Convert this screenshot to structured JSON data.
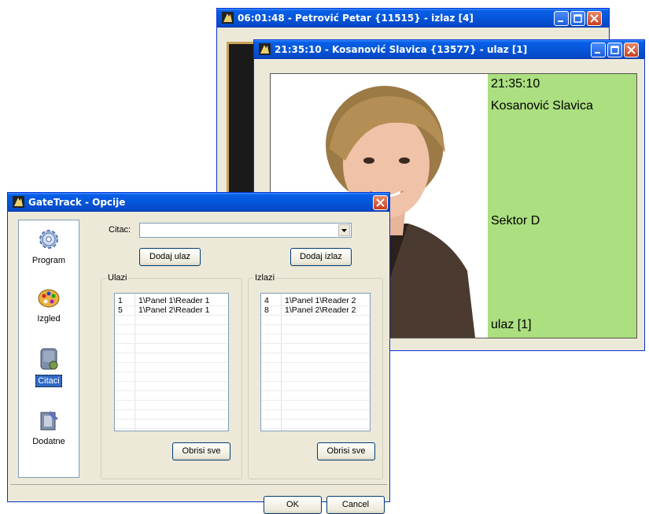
{
  "back_window": {
    "title": "06:01:48 - Petrović Petar {11515} - izlaz [4]"
  },
  "mid_window": {
    "title": "21:35:10 - Kosanović Slavica {13577} - ulaz [1]",
    "time": "21:35:10",
    "name": "Kosanović Slavica",
    "sector": "Sektor D",
    "direction": "ulaz [1]",
    "panel_color": "#acdf80"
  },
  "options_dialog": {
    "title": "GateTrack - Opcije",
    "nav": [
      {
        "label": "Program",
        "icon": "gear-icon"
      },
      {
        "label": "Izgled",
        "icon": "palette-icon"
      },
      {
        "label": "Citaci",
        "icon": "reader-icon",
        "selected": true
      },
      {
        "label": "Dodatne",
        "icon": "addons-icon"
      }
    ],
    "citac_label": "Citac:",
    "citac_value": "",
    "add_entry_button": "Dodaj ulaz",
    "add_exit_button": "Dodaj izlaz",
    "entries_group": "Ulazi",
    "exits_group": "Izlazi",
    "entries": [
      {
        "id": "1",
        "path": "1\\Panel 1\\Reader 1"
      },
      {
        "id": "5",
        "path": "1\\Panel 2\\Reader 1"
      }
    ],
    "exits": [
      {
        "id": "4",
        "path": "1\\Panel 1\\Reader 2"
      },
      {
        "id": "8",
        "path": "1\\Panel 2\\Reader 2"
      }
    ],
    "clear_entries_button": "Obrisi sve",
    "clear_exits_button": "Obrisi sve",
    "ok_button": "OK",
    "cancel_button": "Cancel"
  }
}
